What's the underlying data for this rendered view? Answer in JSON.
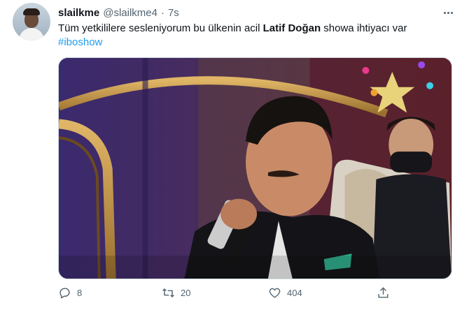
{
  "tweet": {
    "display_name": "slailkme",
    "handle": "@slailkme4",
    "separator": "·",
    "time": "7s",
    "text_before": "Tüm yetkililere sesleniyorum bu ülkenin acil ",
    "text_bold": "Latif Doğan",
    "text_after": " showa ihtiyacı var",
    "hashtag": "#iboshow"
  },
  "actions": {
    "reply_count": "8",
    "retweet_count": "20",
    "like_count": "404"
  },
  "colors": {
    "link": "#1d9bf0",
    "secondary_text": "#536471",
    "primary_text": "#0f1419"
  },
  "icons": {
    "more": "more-dots-icon",
    "reply": "reply-icon",
    "retweet": "retweet-icon",
    "like": "heart-icon",
    "share": "share-icon"
  }
}
